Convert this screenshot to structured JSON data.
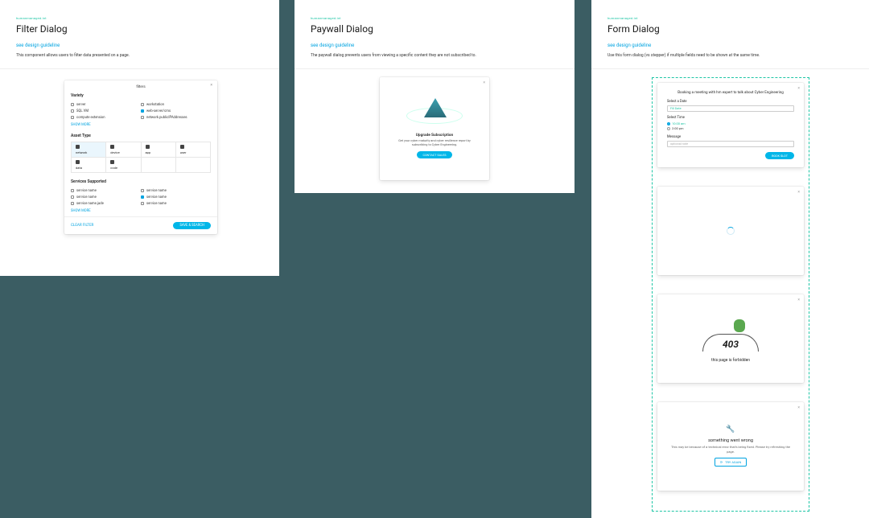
{
  "tag": "humanmanaged.int",
  "frames": {
    "filter": {
      "title": "Filter Dialog",
      "guideline": "see design guideline",
      "desc": "This component allows users to filter data presented on a page.",
      "card_title": "filters",
      "close": "×",
      "variety": {
        "label": "Variety",
        "items": [
          "server",
          "workstation",
          "SQL VM",
          "web-server/cms",
          "compute extension",
          "network.publicIPAddresses"
        ],
        "checked_index": 3,
        "more": "SHOW MORE"
      },
      "asset": {
        "label": "Asset Type",
        "tiles": [
          "network",
          "device",
          "app",
          "user",
          "data",
          "code"
        ],
        "selected_index": 0
      },
      "services": {
        "label": "Services Supported",
        "items": [
          "service name",
          "service name",
          "service name",
          "service name",
          "service name.jade",
          "service name"
        ],
        "checked_index": 3,
        "more": "SHOW MORE"
      },
      "footer": {
        "clear": "CLEAR FILTER",
        "apply": "SAVE & SEARCH"
      }
    },
    "paywall": {
      "title": "Paywall Dialog",
      "guideline": "see design guideline",
      "desc": "The paywall dialog prevents users from viewing a specific content they are not subscribed to.",
      "close": "×",
      "heading": "Upgrade Subscription",
      "body": "Get your cyber maturity and cyber resilience report by subscribing to Cyber Engineering.",
      "cta": "CONTACT SALES"
    },
    "form": {
      "title": "Form Dialog",
      "guideline": "see design guideline",
      "desc": "Use this form dialog (vs stepper) if multiple fields need to be shown at the same time.",
      "booking": {
        "close": "×",
        "heading": "Booking a meeting with hm expert to talk about Cyber Engineering",
        "date_label": "Select a Date",
        "date_value": "Fill Date",
        "time_label": "Select Time",
        "time_opts": [
          "10:00 am",
          "2:00 pm"
        ],
        "time_selected_index": 0,
        "msg_label": "Message",
        "msg_placeholder": "optional note",
        "cta": "BOOK SLOT"
      },
      "spinner": {
        "close": "×"
      },
      "forbidden": {
        "close": "×",
        "code": "403",
        "text": "this page is forbidden"
      },
      "error": {
        "close": "×",
        "heading": "something went wrong",
        "body": "This may be because of a technical error that's being fixed. Please try refreshing the page.",
        "cta": "TRY AGAIN"
      }
    }
  }
}
